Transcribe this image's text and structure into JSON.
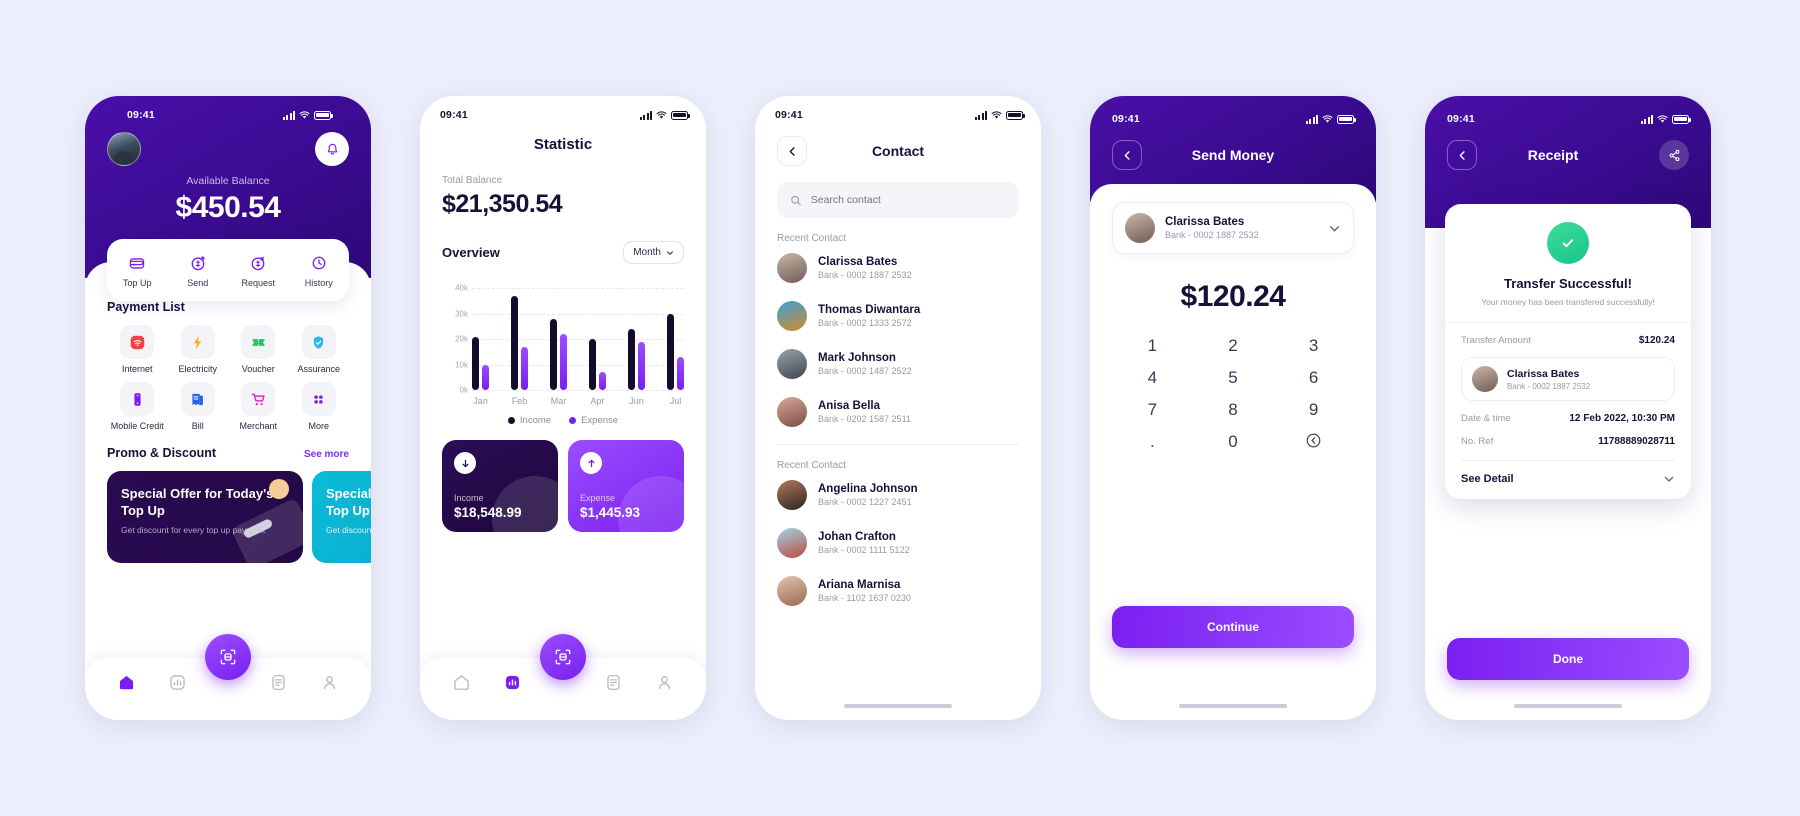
{
  "theme": {
    "primary": "#7a1ff0",
    "primary_light": "#9b4dff",
    "dark": "#2e0878",
    "ink": "#15123a",
    "success": "#17c589"
  },
  "status_bar": {
    "time": "09:41"
  },
  "home": {
    "balance_label": "Available Balance",
    "balance": "$450.54",
    "quick_actions": [
      {
        "label": "Top Up",
        "icon": "wallet-icon"
      },
      {
        "label": "Send",
        "icon": "send-money-icon"
      },
      {
        "label": "Request",
        "icon": "request-money-icon"
      },
      {
        "label": "History",
        "icon": "history-icon"
      }
    ],
    "payment_list_title": "Payment List",
    "payment_items": [
      {
        "label": "Internet",
        "icon": "wifi-icon",
        "color": "#ef4444"
      },
      {
        "label": "Electricity",
        "icon": "bolt-icon",
        "color": "#fbb01b"
      },
      {
        "label": "Voucher",
        "icon": "ticket-icon",
        "color": "#22c55e"
      },
      {
        "label": "Assurance",
        "icon": "shield-icon",
        "color": "#2bb9e8"
      },
      {
        "label": "Mobile Credit",
        "icon": "phone-icon",
        "color": "#7a1ff0"
      },
      {
        "label": "Bill",
        "icon": "bill-icon",
        "color": "#2563eb"
      },
      {
        "label": "Merchant",
        "icon": "cart-icon",
        "color": "#e626c8"
      },
      {
        "label": "More",
        "icon": "grid-icon",
        "color": "#7a1ff0"
      }
    ],
    "promo_title": "Promo & Discount",
    "see_more": "See more",
    "promos": [
      {
        "headline": "Special Offer for Today's Top Up",
        "body": "Get discount for every top up payment"
      },
      {
        "headline": "Special Offer for Today's Top Up",
        "body": "Get discount"
      }
    ],
    "nav": [
      {
        "name": "home",
        "icon": "home-icon",
        "active": true
      },
      {
        "name": "statistic",
        "icon": "chart-icon",
        "active": false
      },
      {
        "name": "scan",
        "icon": "scan-icon",
        "active": false
      },
      {
        "name": "bills",
        "icon": "document-icon",
        "active": false
      },
      {
        "name": "profile",
        "icon": "person-icon",
        "active": false
      }
    ]
  },
  "statistic": {
    "title": "Statistic",
    "total_label": "Total Balance",
    "total": "$21,350.54",
    "overview_label": "Overview",
    "period": "Month",
    "income": {
      "badge_icon": "arrow-down-icon",
      "label": "Income",
      "value": "$18,548.99"
    },
    "expense": {
      "badge_icon": "arrow-up-icon",
      "label": "Expense",
      "value": "$1,445.93"
    }
  },
  "chart_data": {
    "type": "bar",
    "title": "Overview",
    "categories": [
      "Jan",
      "Feb",
      "Mar",
      "Apr",
      "Jun",
      "Jul"
    ],
    "series": [
      {
        "name": "Income",
        "color": "#130b2b",
        "values": [
          21000,
          37000,
          28000,
          20000,
          24000,
          30000
        ]
      },
      {
        "name": "Expense",
        "color": "#7a1ff0",
        "values": [
          10000,
          17000,
          22000,
          7000,
          19000,
          13000
        ]
      }
    ],
    "ytick_labels": [
      "40k",
      "30k",
      "20k",
      "10k",
      "0k"
    ],
    "ytick_values": [
      40000,
      30000,
      20000,
      10000,
      0
    ],
    "ylim": [
      0,
      44000
    ],
    "grid": true,
    "legend_position": "bottom",
    "xlabel": "",
    "ylabel": ""
  },
  "contact": {
    "title": "Contact",
    "search_placeholder": "Search contact",
    "search_value": "",
    "section_1_label": "Recent Contact",
    "section_2_label": "Recent Contact",
    "recent": [
      {
        "name": "Clarissa Bates",
        "bank": "Bank - 0002 1887 2532",
        "avatar": "f-av1"
      },
      {
        "name": "Thomas Diwantara",
        "bank": "Bank - 0002 1333 2572",
        "avatar": "f-av2"
      },
      {
        "name": "Mark Johnson",
        "bank": "Bank - 0002 1487 2522",
        "avatar": "f-av3"
      },
      {
        "name": "Anisa Bella",
        "bank": "Bank - 0202 1587 2511",
        "avatar": "f-av4"
      }
    ],
    "all": [
      {
        "name": "Angelina Johnson",
        "bank": "Bank - 0002 1227 2451",
        "avatar": "f-av5"
      },
      {
        "name": "Johan Crafton",
        "bank": "Bank - 0002 1111 5122",
        "avatar": "f-av6"
      },
      {
        "name": "Ariana Marnisa",
        "bank": "Bank - 1102 1637 0230",
        "avatar": "f-av7"
      }
    ]
  },
  "send_money": {
    "title": "Send Money",
    "recipient": {
      "name": "Clarissa Bates",
      "bank": "Bank - 0002 1887 2532",
      "avatar": "f-av1"
    },
    "amount": "$120.24",
    "keys": [
      "1",
      "2",
      "3",
      "4",
      "5",
      "6",
      "7",
      "8",
      "9",
      ".",
      "0",
      "backspace-icon"
    ],
    "cta": "Continue"
  },
  "receipt": {
    "title": "Receipt",
    "status_title": "Transfer Successful!",
    "status_sub": "Your money has been transfered successfully!",
    "rows": [
      {
        "key": "Transfer Amount",
        "value": "$120.24"
      }
    ],
    "recipient": {
      "name": "Clarissa Bates",
      "bank": "Bank - 0002 1887 2532",
      "avatar": "f-av1"
    },
    "details": [
      {
        "key": "Date & time",
        "value": "12 Feb 2022, 10:30 PM"
      },
      {
        "key": "No. Ref",
        "value": "11788889028711"
      }
    ],
    "see_detail": "See Detail",
    "cta": "Done"
  }
}
